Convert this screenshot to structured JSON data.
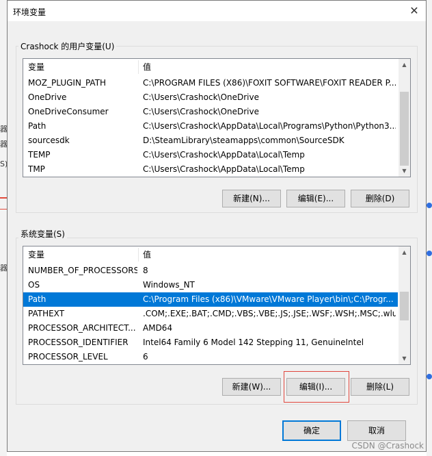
{
  "window": {
    "title": "环境变量",
    "close_icon": "close-icon"
  },
  "user_vars": {
    "label": "Crashock 的用户变量(U)",
    "columns": [
      "变量",
      "值"
    ],
    "rows": [
      {
        "name": "MOZ_PLUGIN_PATH",
        "value": "C:\\PROGRAM FILES (X86)\\FOXIT SOFTWARE\\FOXIT READER P..."
      },
      {
        "name": "OneDrive",
        "value": "C:\\Users\\Crashock\\OneDrive"
      },
      {
        "name": "OneDriveConsumer",
        "value": "C:\\Users\\Crashock\\OneDrive"
      },
      {
        "name": "Path",
        "value": "C:\\Users\\Crashock\\AppData\\Local\\Programs\\Python\\Python3..."
      },
      {
        "name": "sourcesdk",
        "value": "D:\\SteamLibrary\\steamapps\\common\\SourceSDK"
      },
      {
        "name": "TEMP",
        "value": "C:\\Users\\Crashock\\AppData\\Local\\Temp"
      },
      {
        "name": "TMP",
        "value": "C:\\Users\\Crashock\\AppData\\Local\\Temp"
      }
    ],
    "buttons": {
      "new": "新建(N)...",
      "edit": "编辑(E)...",
      "delete": "删除(D)"
    }
  },
  "system_vars": {
    "label": "系统变量(S)",
    "columns": [
      "变量",
      "值"
    ],
    "rows": [
      {
        "name": "NUMBER_OF_PROCESSORS",
        "value": "8"
      },
      {
        "name": "OS",
        "value": "Windows_NT"
      },
      {
        "name": "Path",
        "value": "C:\\Program Files (x86)\\VMware\\VMware Player\\bin\\;C:\\Progr..."
      },
      {
        "name": "PATHEXT",
        "value": ".COM;.EXE;.BAT;.CMD;.VBS;.VBE;.JS;.JSE;.WSF;.WSH;.MSC;.wlua..."
      },
      {
        "name": "PROCESSOR_ARCHITECT...",
        "value": "AMD64"
      },
      {
        "name": "PROCESSOR_IDENTIFIER",
        "value": "Intel64 Family 6 Model 142 Stepping 11, GenuineIntel"
      },
      {
        "name": "PROCESSOR_LEVEL",
        "value": "6"
      }
    ],
    "selected_index": 2,
    "buttons": {
      "new": "新建(W)...",
      "edit": "编辑(I)...",
      "delete": "删除(L)"
    }
  },
  "footer": {
    "ok": "确定",
    "cancel": "取消"
  },
  "watermark": "CSDN @Crashock",
  "background_left_chars": [
    "器",
    "器",
    "S)",
    "器"
  ],
  "colors": {
    "selection": "#0078d7",
    "highlight": "#e0463c"
  }
}
